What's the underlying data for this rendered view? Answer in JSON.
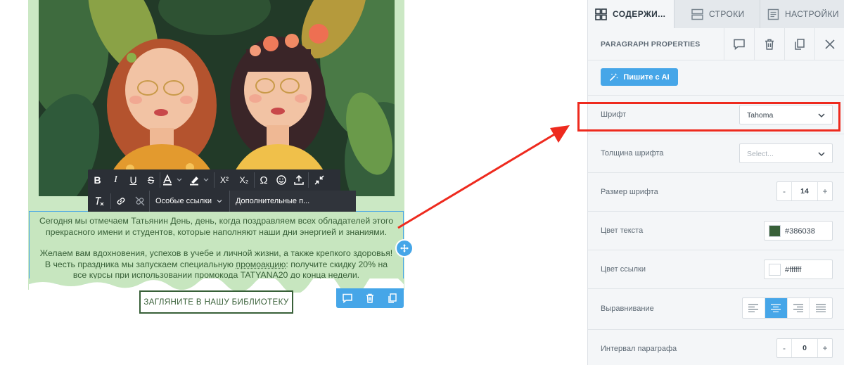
{
  "canvas": {
    "text_block": {
      "paragraph1_line1": "Сегодня мы отмечаем Татьянин День, день, когда поздравляем всех обладателей этого",
      "paragraph1_line2": "прекрасного имени и студентов, которые наполняют наши дни энергией и знаниями.",
      "paragraph2_line1": "Желаем вам вдохновения, успехов в учебе и личной жизни, а также крепкого здоровья!",
      "paragraph2_line2_before": "В честь праздника мы запускаем специальную ",
      "paragraph2_line2_link": "промоакцию",
      "paragraph2_line2_after": ": получите скидку 20% на",
      "paragraph2_line3": "все курсы при использовании промокода TATYANA20 до конца недели."
    },
    "cta_button": "ЗАГЛЯНИТЕ В НАШУ БИБЛИОТЕКУ",
    "toolbar": {
      "bold": "B",
      "italic": "I",
      "underline": "U",
      "strike": "S",
      "superscript": "X²",
      "subscript": "X₂",
      "omega": "Ω",
      "special_links": "Особые ссылки",
      "more_params": "Дополнительные п..."
    }
  },
  "panel": {
    "tabs": [
      {
        "label": "СОДЕРЖИ...",
        "active": true,
        "icon": "grid-icon"
      },
      {
        "label": "СТРОКИ",
        "active": false,
        "icon": "rows-icon"
      },
      {
        "label": "НАСТРОЙКИ",
        "active": false,
        "icon": "settings-doc-icon"
      }
    ],
    "properties_title": "PARAGRAPH PROPERTIES",
    "ai_button": "Пишите с AI",
    "font": {
      "label": "Шрифт",
      "value": "Tahoma"
    },
    "font_weight": {
      "label": "Толщина шрифта",
      "placeholder": "Select..."
    },
    "font_size": {
      "label": "Размер шрифта",
      "value": "14",
      "minus": "-",
      "plus": "+"
    },
    "text_color": {
      "label": "Цвет текста",
      "value": "#386038"
    },
    "link_color": {
      "label": "Цвет ссылки",
      "value": "#ffffff"
    },
    "alignment": {
      "label": "Выравнивание",
      "active": "center"
    },
    "paragraph_spacing": {
      "label": "Интервал параграфа",
      "value": "0",
      "minus": "-",
      "plus": "+"
    }
  },
  "colors": {
    "accent": "#46a6e8",
    "text_color": "#386038",
    "highlight": "#ee2a1e",
    "canvas_green": "#cbe8c4"
  }
}
